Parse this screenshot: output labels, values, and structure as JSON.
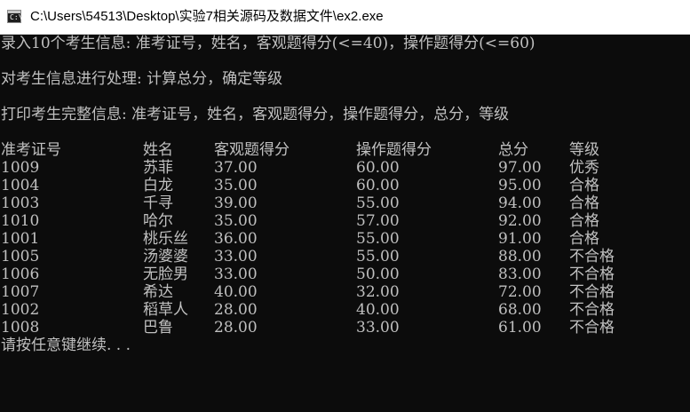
{
  "window": {
    "title": "C:\\Users\\54513\\Desktop\\实验7相关源码及数据文件\\ex2.exe"
  },
  "console": {
    "prompt_input": "录入10个考生信息: 准考证号，姓名，客观题得分(<=40)，操作题得分(<=60)",
    "prompt_process": "对考生信息进行处理: 计算总分，确定等级",
    "prompt_print": "打印考生完整信息: 准考证号，姓名，客观题得分，操作题得分，总分，等级",
    "table": {
      "headers": [
        "准考证号",
        "姓名",
        "客观题得分",
        "操作题得分",
        "总分",
        "等级"
      ],
      "rows": [
        [
          "1009",
          "苏菲",
          "37.00",
          "60.00",
          "97.00",
          "优秀"
        ],
        [
          "1004",
          "白龙",
          "35.00",
          "60.00",
          "95.00",
          "合格"
        ],
        [
          "1003",
          "千寻",
          "39.00",
          "55.00",
          "94.00",
          "合格"
        ],
        [
          "1010",
          "哈尔",
          "35.00",
          "57.00",
          "92.00",
          "合格"
        ],
        [
          "1001",
          "桃乐丝",
          "36.00",
          "55.00",
          "91.00",
          "合格"
        ],
        [
          "1005",
          "汤婆婆",
          "33.00",
          "55.00",
          "88.00",
          "不合格"
        ],
        [
          "1006",
          "无脸男",
          "33.00",
          "50.00",
          "83.00",
          "不合格"
        ],
        [
          "1007",
          "希达",
          "40.00",
          "32.00",
          "72.00",
          "不合格"
        ],
        [
          "1002",
          "稻草人",
          "28.00",
          "40.00",
          "68.00",
          "不合格"
        ],
        [
          "1008",
          "巴鲁",
          "28.00",
          "33.00",
          "61.00",
          "不合格"
        ]
      ]
    },
    "press_any_key": "请按任意键继续. . ."
  }
}
